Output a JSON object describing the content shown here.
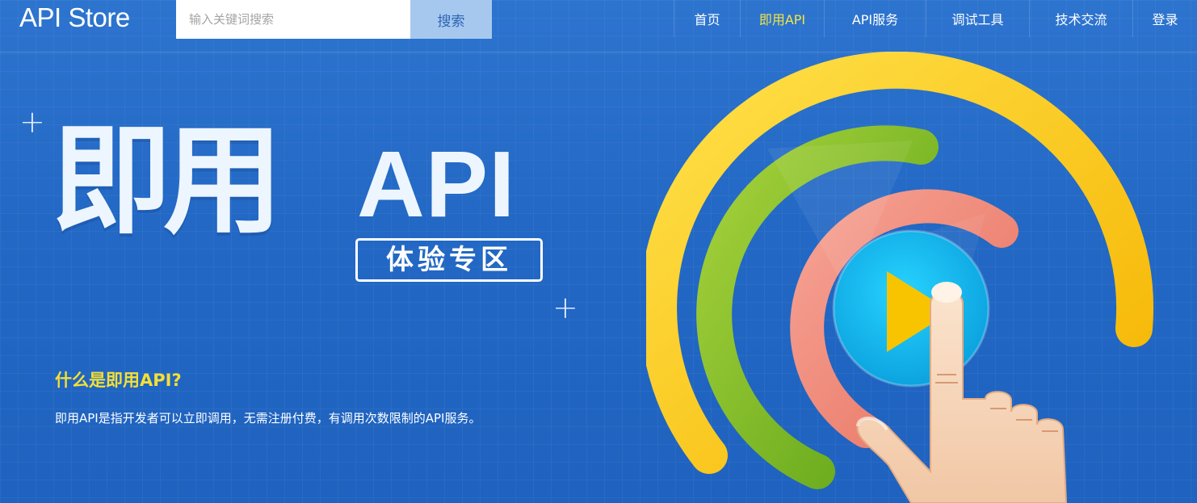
{
  "header": {
    "logo_text": "API Store",
    "search": {
      "placeholder": "输入关键词搜索",
      "value": "",
      "button_label": "搜索"
    },
    "nav": [
      {
        "label": "首页",
        "active": false
      },
      {
        "label": "即用API",
        "active": true
      },
      {
        "label": "API服务",
        "active": false
      },
      {
        "label": "调试工具",
        "active": false
      },
      {
        "label": "技术交流",
        "active": false
      },
      {
        "label": "登录",
        "active": false
      }
    ]
  },
  "hero": {
    "title_cn": "即用",
    "title_api": "API",
    "badge": "体验专区",
    "question": "什么是即用API?",
    "description": "即用API是指开发者可以立即调用，无需注册付费，有调用次数限制的API服务。"
  },
  "decorations": {
    "plus_glyph": "+"
  },
  "colors": {
    "background_blue": "#2268c4",
    "nav_active": "#f3e442",
    "question_yellow": "#f4df35",
    "search_button_bg": "#a7c8ee"
  },
  "icons": {
    "illustration": "hand-tapping-play-button-with-rings"
  }
}
